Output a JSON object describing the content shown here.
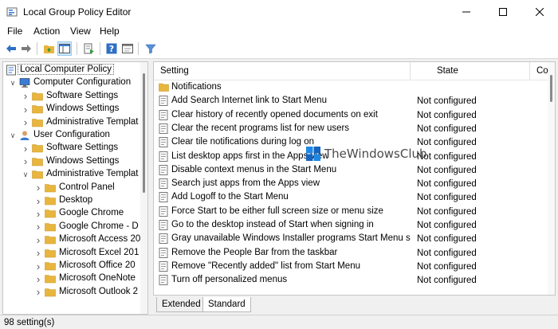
{
  "window": {
    "title": "Local Group Policy Editor"
  },
  "menu": {
    "items": [
      "File",
      "Action",
      "View",
      "Help"
    ]
  },
  "toolbar": {
    "buttons": [
      "back-arrow-icon",
      "forward-arrow-icon",
      "folder-up-icon",
      "show-hide-tree-icon",
      "export-list-icon",
      "help-icon",
      "properties-icon",
      "filter-icon"
    ]
  },
  "tree": {
    "root": "Local Computer Policy",
    "items": [
      {
        "label": "Computer Configuration",
        "level": 1,
        "expanded": true
      },
      {
        "label": "Software Settings",
        "level": 2,
        "expanded": false
      },
      {
        "label": "Windows Settings",
        "level": 2,
        "expanded": false
      },
      {
        "label": "Administrative Templat",
        "level": 2,
        "expanded": false
      },
      {
        "label": "User Configuration",
        "level": 1,
        "expanded": true
      },
      {
        "label": "Software Settings",
        "level": 2,
        "expanded": false
      },
      {
        "label": "Windows Settings",
        "level": 2,
        "expanded": false
      },
      {
        "label": "Administrative Templat",
        "level": 2,
        "expanded": true
      },
      {
        "label": "Control Panel",
        "level": 3,
        "expanded": false
      },
      {
        "label": "Desktop",
        "level": 3,
        "expanded": false
      },
      {
        "label": "Google Chrome",
        "level": 3,
        "expanded": false
      },
      {
        "label": "Google Chrome - D",
        "level": 3,
        "expanded": false
      },
      {
        "label": "Microsoft Access 20",
        "level": 3,
        "expanded": false
      },
      {
        "label": "Microsoft Excel 201",
        "level": 3,
        "expanded": false
      },
      {
        "label": "Microsoft Office 20",
        "level": 3,
        "expanded": false
      },
      {
        "label": "Microsoft OneNote",
        "level": 3,
        "expanded": false
      },
      {
        "label": "Microsoft Outlook 2",
        "level": 3,
        "expanded": false
      }
    ]
  },
  "list": {
    "headers": {
      "setting": "Setting",
      "state": "State",
      "comment": "Co"
    },
    "folder": "Notifications",
    "rows": [
      {
        "name": "Add Search Internet link to Start Menu",
        "state": "Not configured"
      },
      {
        "name": "Clear history of recently opened documents on exit",
        "state": "Not configured"
      },
      {
        "name": "Clear the recent programs list for new users",
        "state": "Not configured"
      },
      {
        "name": "Clear tile notifications during log on",
        "state": "Not configured"
      },
      {
        "name": "List desktop apps first in the Apps view",
        "state": "Not configured"
      },
      {
        "name": "Disable context menus in the Start Menu",
        "state": "Not configured"
      },
      {
        "name": "Search just apps from the Apps view",
        "state": "Not configured"
      },
      {
        "name": "Add Logoff to the Start Menu",
        "state": "Not configured"
      },
      {
        "name": "Force Start to be either full screen size or menu size",
        "state": "Not configured"
      },
      {
        "name": "Go to the desktop instead of Start when signing in",
        "state": "Not configured"
      },
      {
        "name": "Gray unavailable Windows Installer programs Start Menu sh...",
        "state": "Not configured"
      },
      {
        "name": "Remove the People Bar from the taskbar",
        "state": "Not configured"
      },
      {
        "name": "Remove \"Recently added\" list from Start Menu",
        "state": "Not configured"
      },
      {
        "name": "Turn off personalized menus",
        "state": "Not configured"
      }
    ]
  },
  "tabs": {
    "extended": "Extended",
    "standard": "Standard"
  },
  "status": {
    "text": "98 setting(s)"
  },
  "watermark": {
    "text": "TheWindowsClub"
  },
  "colors": {
    "folder": "#e8b63e",
    "accent": "#0f6cbd",
    "selection": "#cce8ff"
  }
}
